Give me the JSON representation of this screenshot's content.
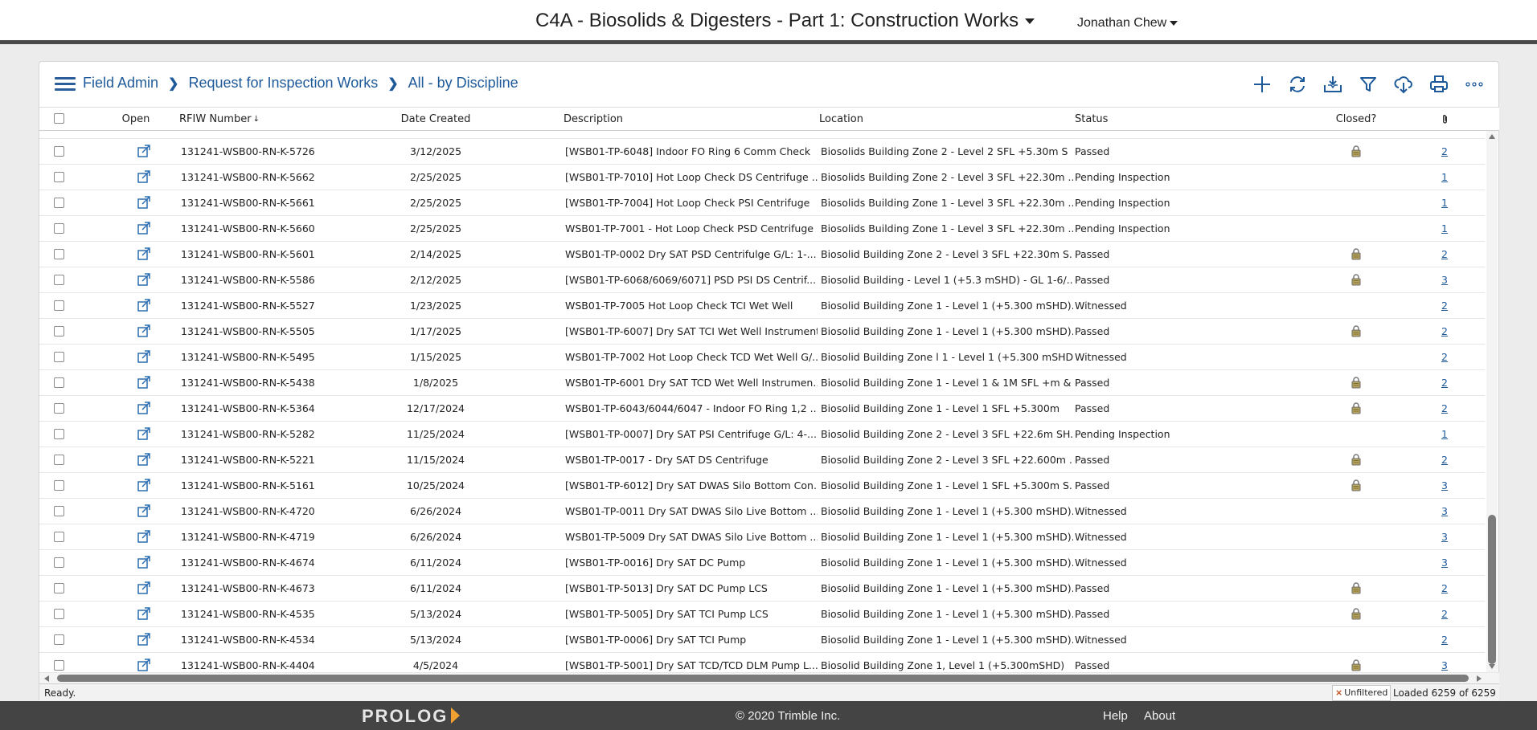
{
  "header": {
    "title": "C4A - Biosolids & Digesters - Part 1: Construction Works",
    "user": "Jonathan Chew"
  },
  "breadcrumb": {
    "items": [
      "Field Admin",
      "Request for Inspection Works",
      "All - by Discipline"
    ]
  },
  "toolbar": {
    "icons": [
      "add-icon",
      "refresh-icon",
      "import-icon",
      "filter-icon",
      "download-cloud-icon",
      "print-icon",
      "more-icon"
    ]
  },
  "grid": {
    "columns": {
      "open": "Open",
      "number": "RFIW Number",
      "sort_indicator": "↓",
      "date": "Date Created",
      "description": "Description",
      "location": "Location",
      "status": "Status",
      "closed": "Closed?"
    },
    "rows": [
      {
        "number": "131241-WSB00-RN-K-5726",
        "date": "3/12/2025",
        "description": "[WSB01-TP-6048] Indoor FO Ring 6 Comm Check",
        "location": "Biosolids Building Zone 2 - Level 2 SFL +5.30m S",
        "status": "Passed",
        "closed": true,
        "attachments": "2"
      },
      {
        "number": "131241-WSB00-RN-K-5662",
        "date": "2/25/2025",
        "description": "[WSB01-TP-7010] Hot Loop Check DS Centrifuge ...",
        "location": "Biosolids Building Zone 2 - Level 3 SFL +22.30m ...",
        "status": "Pending Inspection",
        "closed": false,
        "attachments": "1"
      },
      {
        "number": "131241-WSB00-RN-K-5661",
        "date": "2/25/2025",
        "description": "[WSB01-TP-7004] Hot Loop Check PSI Centrifuge",
        "location": "Biosolids Building Zone 1 - Level 3 SFL +22.30m ...",
        "status": "Pending Inspection",
        "closed": false,
        "attachments": "1"
      },
      {
        "number": "131241-WSB00-RN-K-5660",
        "date": "2/25/2025",
        "description": "WSB01-TP-7001 - Hot Loop Check PSD Centrifuge",
        "location": "Biosolids Building Zone 1 - Level 3 SFL +22.30m ...",
        "status": "Pending Inspection",
        "closed": false,
        "attachments": "1"
      },
      {
        "number": "131241-WSB00-RN-K-5601",
        "date": "2/14/2025",
        "description": "WSB01-TP-0002 Dry SAT PSD Centrifulge G/L: 1-...",
        "location": "Biosolid Building Zone 2 - Level 3 SFL +22.30m S...",
        "status": "Passed",
        "closed": true,
        "attachments": "2"
      },
      {
        "number": "131241-WSB00-RN-K-5586",
        "date": "2/12/2025",
        "description": "[WSB01-TP-6068/6069/6071] PSD PSI DS Centrif...",
        "location": "Biosolid Building - Level 1 (+5.3 mSHD) - GL 1-6/...",
        "status": "Passed",
        "closed": true,
        "attachments": "3"
      },
      {
        "number": "131241-WSB00-RN-K-5527",
        "date": "1/23/2025",
        "description": "WSB01-TP-7005 Hot Loop Check TCI Wet Well",
        "location": "Biosolid Building Zone 1 - Level 1 (+5.300 mSHD)...",
        "status": "Witnessed",
        "closed": false,
        "attachments": "2"
      },
      {
        "number": "131241-WSB00-RN-K-5505",
        "date": "1/17/2025",
        "description": "[WSB01-TP-6007] Dry SAT TCI Wet Well Instrument",
        "location": "Biosolid Building Zone 1 - Level 1 (+5.300 mSHD)...",
        "status": "Passed",
        "closed": true,
        "attachments": "2"
      },
      {
        "number": "131241-WSB00-RN-K-5495",
        "date": "1/15/2025",
        "description": "WSB01-TP-7002 Hot Loop Check TCD Wet Well G/...",
        "location": "Biosolid Building Zone l 1 - Level 1 (+5.300 mSHD...",
        "status": "Witnessed",
        "closed": false,
        "attachments": "2"
      },
      {
        "number": "131241-WSB00-RN-K-5438",
        "date": "1/8/2025",
        "description": "WSB01-TP-6001 Dry SAT TCD Wet Well Instrumen...",
        "location": "Biosolid Building Zone 1 - Level 1 & 1M SFL +m & ...",
        "status": "Passed",
        "closed": true,
        "attachments": "2"
      },
      {
        "number": "131241-WSB00-RN-K-5364",
        "date": "12/17/2024",
        "description": "WSB01-TP-6043/6044/6047 - Indoor FO Ring 1,2 ...",
        "location": "Biosolid Building Zone 1 - Level 1 SFL +5.300m",
        "status": "Passed",
        "closed": true,
        "attachments": "2"
      },
      {
        "number": "131241-WSB00-RN-K-5282",
        "date": "11/25/2024",
        "description": "[WSB01-TP-0007] Dry SAT PSI Centrifuge G/L: 4-...",
        "location": "Biosolid Building Zone 2 - Level 3 SFL +22.6m SH...",
        "status": "Pending Inspection",
        "closed": false,
        "attachments": "1"
      },
      {
        "number": "131241-WSB00-RN-K-5221",
        "date": "11/15/2024",
        "description": "WSB01-TP-0017 - Dry SAT DS Centrifuge",
        "location": "Biosolid Building Zone 2 - Level 3 SFL +22.600m ...",
        "status": "Passed",
        "closed": true,
        "attachments": "2"
      },
      {
        "number": "131241-WSB00-RN-K-5161",
        "date": "10/25/2024",
        "description": "[WSB01-TP-6012] Dry SAT DWAS Silo Bottom Con...",
        "location": "Biosolid Building Zone 1 - Level 1 SFL +5.300m S...",
        "status": "Passed",
        "closed": true,
        "attachments": "3"
      },
      {
        "number": "131241-WSB00-RN-K-4720",
        "date": "6/26/2024",
        "description": "WSB01-TP-0011 Dry SAT DWAS Silo Live Bottom ...",
        "location": "Biosolid Building Zone 1 - Level 1 (+5.300 mSHD)...",
        "status": "Witnessed",
        "closed": false,
        "attachments": "3"
      },
      {
        "number": "131241-WSB00-RN-K-4719",
        "date": "6/26/2024",
        "description": "WSB01-TP-5009 Dry SAT DWAS Silo Live Bottom ...",
        "location": "Biosolid Building Zone 1 - Level 1 (+5.300 mSHD)...",
        "status": "Witnessed",
        "closed": false,
        "attachments": "3"
      },
      {
        "number": "131241-WSB00-RN-K-4674",
        "date": "6/11/2024",
        "description": "[WSB01-TP-0016] Dry SAT DC Pump",
        "location": "Biosolid Building Zone 1 - Level 1 (+5.300 mSHD)...",
        "status": "Witnessed",
        "closed": false,
        "attachments": "3"
      },
      {
        "number": "131241-WSB00-RN-K-4673",
        "date": "6/11/2024",
        "description": "[WSB01-TP-5013] Dry SAT DC Pump LCS",
        "location": "Biosolid Building Zone 1 - Level 1 (+5.300 mSHD)...",
        "status": "Passed",
        "closed": true,
        "attachments": "2"
      },
      {
        "number": "131241-WSB00-RN-K-4535",
        "date": "5/13/2024",
        "description": "[WSB01-TP-5005] Dry SAT TCI Pump LCS",
        "location": "Biosolid Building Zone 1 - Level 1 (+5.300 mSHD)...",
        "status": "Passed",
        "closed": true,
        "attachments": "2"
      },
      {
        "number": "131241-WSB00-RN-K-4534",
        "date": "5/13/2024",
        "description": "[WSB01-TP-0006] Dry SAT TCI Pump",
        "location": "Biosolid Building Zone 1 - Level 1 (+5.300 mSHD)...",
        "status": "Witnessed",
        "closed": false,
        "attachments": "2"
      },
      {
        "number": "131241-WSB00-RN-K-4404",
        "date": "4/5/2024",
        "description": "[WSB01-TP-5001] Dry SAT TCD/TCD DLM Pump L...",
        "location": "Biosolid Building Zone 1, Level 1 (+5.300mSHD)",
        "status": "Passed",
        "closed": true,
        "attachments": "3"
      }
    ]
  },
  "statusbar": {
    "status": "Ready.",
    "filter_state": "Unfiltered",
    "loaded": "Loaded 6259 of 6259"
  },
  "footer": {
    "brand": "PROLOG",
    "copyright": "© 2020 Trimble Inc.",
    "help": "Help",
    "about": "About"
  }
}
